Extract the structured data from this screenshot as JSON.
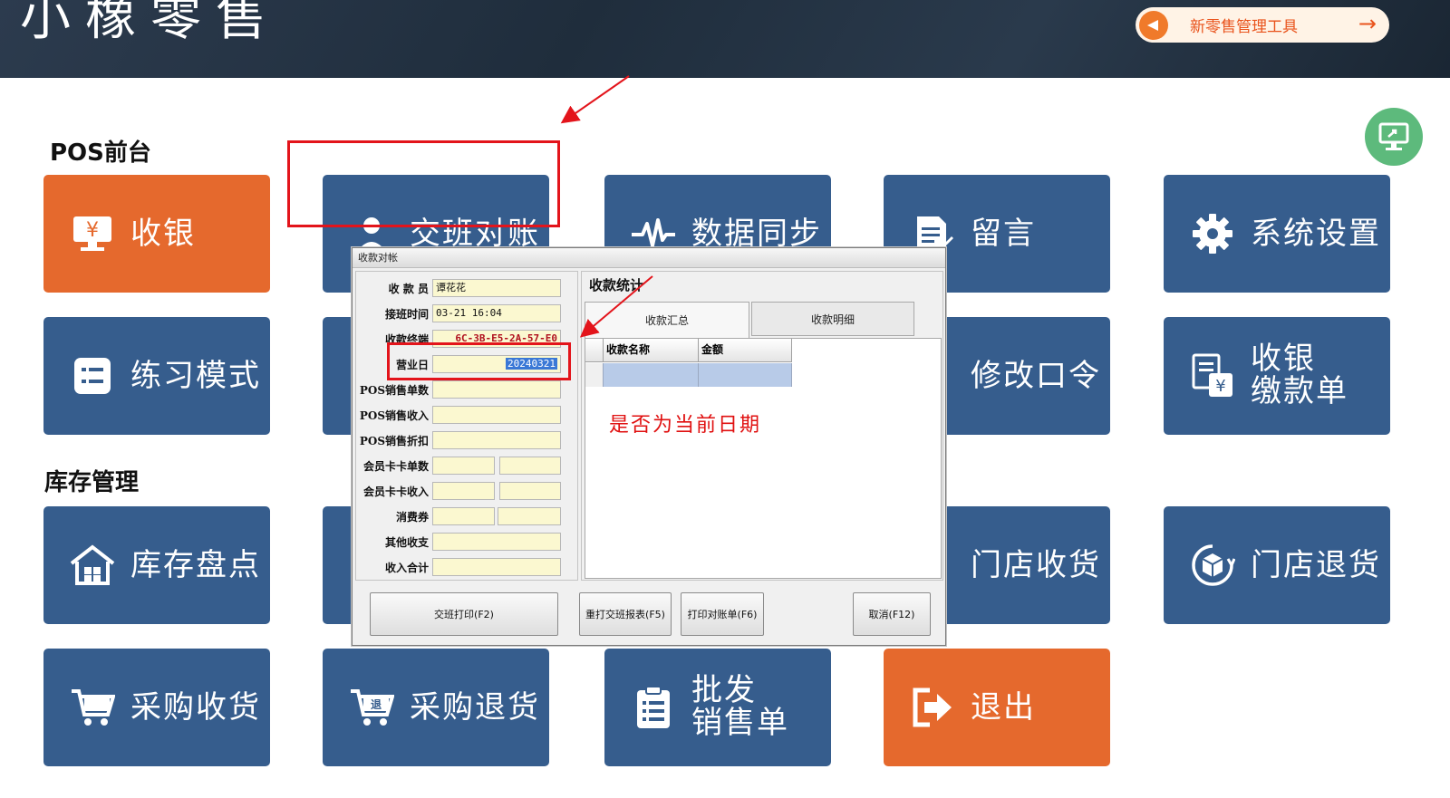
{
  "banner": {
    "title": "小橡零售",
    "promo_label": "新零售管理工具",
    "promo_arrow": "→"
  },
  "sections": {
    "pos": "POS前台",
    "inventory": "库存管理"
  },
  "tiles": {
    "cashier": "收银",
    "shift": "交班对账",
    "sync": "数据同步",
    "message": "留言",
    "settings": "系统设置",
    "practice": "练习模式",
    "password": "修改口令",
    "pay_slip_1": "收银",
    "pay_slip_2": "缴款单",
    "stocktake": "库存盘点",
    "store_receive": "门店收货",
    "store_return": "门店退货",
    "purchase_receive": "采购收货",
    "purchase_return": "采购退货",
    "wholesale_1": "批发",
    "wholesale_2": "销售单",
    "exit": "退出"
  },
  "dialog": {
    "title": "收款对帐",
    "labels": {
      "cashier": "收 款 员",
      "shift_time": "接班时间",
      "terminal": "收款终端",
      "business_day": "营业日",
      "pos_count": "POS销售单数",
      "pos_income": "POS销售收入",
      "pos_discount": "POS销售折扣",
      "member_count": "会员卡卡单数",
      "member_income": "会员卡卡收入",
      "voucher": "消费券",
      "other": "其他收支",
      "total": "收入合计"
    },
    "values": {
      "cashier": "谭花花",
      "shift_time": "03-21 16:04",
      "terminal": "6C-3B-E5-2A-57-E0",
      "business_day": "20240321"
    },
    "stats_title": "收款统计",
    "tabs": [
      "收款汇总",
      "收款明细"
    ],
    "columns": [
      "收款名称",
      "金额"
    ],
    "annotation": "是否为当前日期",
    "buttons": {
      "print_shift": "交班打印(F2)",
      "reprint": "重打交班报表(F5)",
      "print_recon": "打印对账单(F6)",
      "cancel": "取消(F12)"
    }
  },
  "colors": {
    "tile_blue": "#365d8d",
    "tile_orange": "#e5692d",
    "annotation_red": "#e3141b"
  }
}
